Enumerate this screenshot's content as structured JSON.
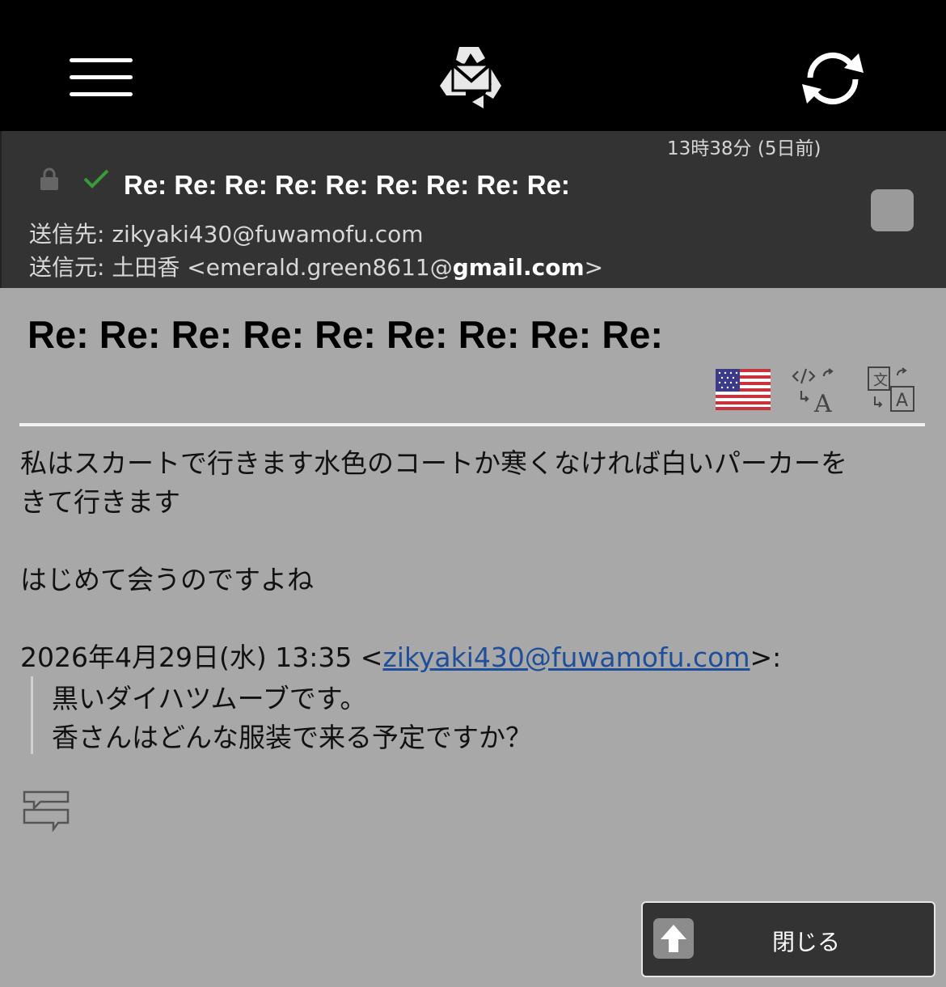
{
  "toolbar": {
    "menu_icon": "hamburger-menu-icon",
    "logo_icon": "recycle-mail-logo",
    "refresh_icon": "refresh-icon"
  },
  "header": {
    "time": "13時38分 (5日前)",
    "subject": "Re: Re: Re: Re: Re: Re: Re: Re: Re:",
    "to_label": "送信先: ",
    "to_address": "zikyaki430@fuwamofu.com",
    "from_label": "送信元: ",
    "from_name": "土田香",
    "from_address_prefix": " <emerald.green8611@",
    "from_address_domain": "gmail.com",
    "from_address_suffix": ">"
  },
  "message": {
    "subject": "Re: Re: Re: Re: Re: Re: Re: Re: Re:",
    "body_line1": "私はスカートで行きます水色のコートか寒くなければ白いパーカーを",
    "body_line2": "きて行きます",
    "body_line3": "はじめて会うのですよね",
    "quote_header_prefix": "2026年4月29日(水) 13:35 <",
    "quote_header_link": "zikyaki430@fuwamofu.com",
    "quote_header_suffix": ">:",
    "quote_line1": "黒いダイハツムーブです。",
    "quote_line2": "香さんはどんな服装で来る予定ですか？"
  },
  "tools": {
    "flag_icon": "us-flag-icon",
    "code_translate_icon": "code-translate-icon",
    "translate_icon": "translate-icon",
    "reply_icon": "reply-icon"
  },
  "close_button": {
    "label": "閉じる"
  },
  "colors": {
    "background": "#a8a8a8",
    "header_panel": "#333333",
    "topbar": "#000000",
    "link": "#1f4f9a",
    "check": "#3a9a3a"
  }
}
